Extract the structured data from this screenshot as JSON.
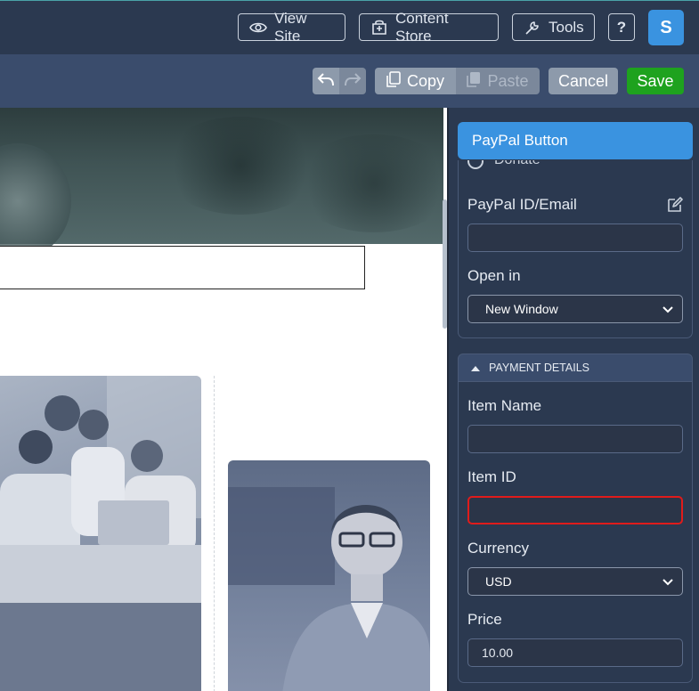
{
  "topbar": {
    "view_site": "View Site",
    "content_store": "Content Store",
    "tools": "Tools",
    "help": "?",
    "avatar_letter": "S"
  },
  "toolbar": {
    "copy": "Copy",
    "paste": "Paste",
    "cancel": "Cancel",
    "save": "Save"
  },
  "panel": {
    "title": "PayPal Button",
    "donate_partial": "Donate",
    "paypal_id_label": "PayPal ID/Email",
    "paypal_id_value": "",
    "open_in_label": "Open in",
    "open_in_value": "New Window",
    "payment_section": "PAYMENT DETAILS",
    "item_name_label": "Item Name",
    "item_name_value": "",
    "item_id_label": "Item ID",
    "item_id_value": "",
    "currency_label": "Currency",
    "currency_value": "USD",
    "price_label": "Price",
    "price_value": "10.00"
  },
  "colors": {
    "topbar_bg": "#2b3950",
    "accent_blue": "#3a93e0",
    "save_green": "#1ea21e",
    "error_red": "#e01b1b"
  }
}
